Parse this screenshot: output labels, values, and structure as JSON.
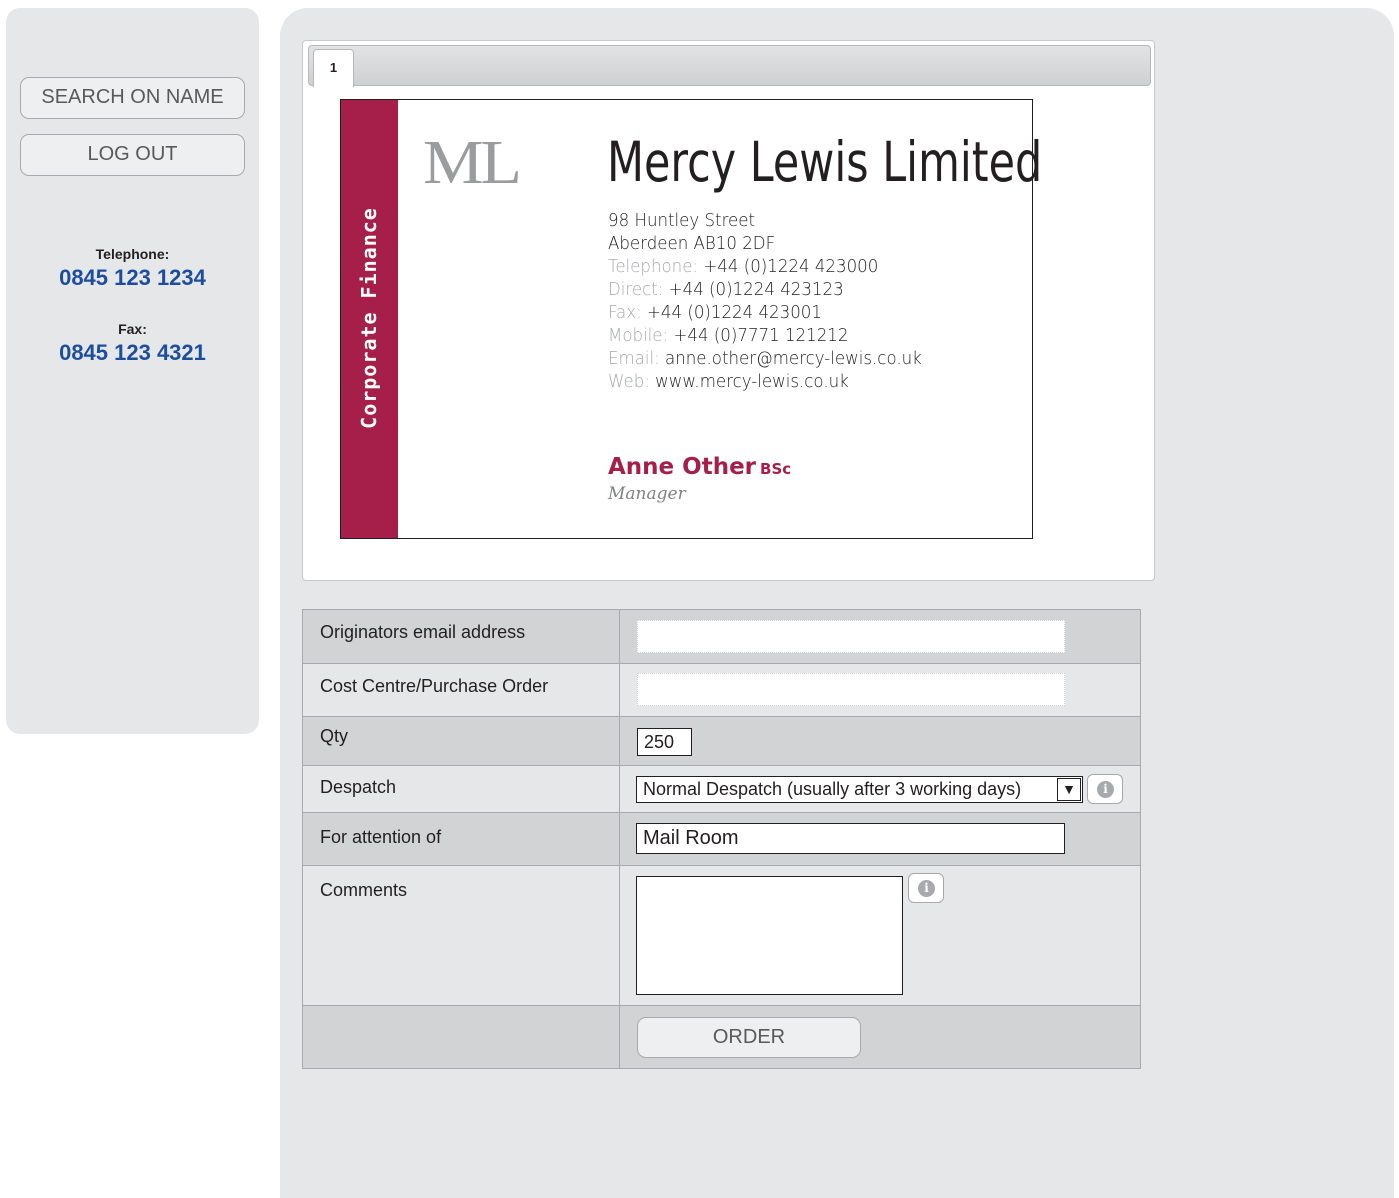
{
  "sidebar": {
    "search_label": "SEARCH ON NAME",
    "logout_label": "LOG OUT",
    "telephone_label": "Telephone:",
    "telephone_value": "0845 123 1234",
    "fax_label": "Fax:",
    "fax_value": "0845 123 4321"
  },
  "proof": {
    "tabs": [
      {
        "label": "1"
      }
    ],
    "card": {
      "strip_text": "Corporate Finance",
      "logo": "ML",
      "company": "Mercy Lewis Limited",
      "address_line1": "98 Huntley Street",
      "address_line2": "Aberdeen AB10 2DF",
      "telephone_label": "Telephone:",
      "telephone_value": "+44 (0)1224 423000",
      "direct_label": "Direct:",
      "direct_value": "+44 (0)1224 423123",
      "fax_label": "Fax:",
      "fax_value": "+44 (0)1224 423001",
      "mobile_label": "Mobile:",
      "mobile_value": "+44 (0)7771 121212",
      "email_label": "Email:",
      "email_value": "anne.other@mercy-lewis.co.uk",
      "web_label": "Web:",
      "web_value": "www.mercy-lewis.co.uk",
      "name": "Anne Other",
      "name_suffix": "BSc",
      "role": "Manager"
    }
  },
  "form": {
    "email_label": "Originators email address",
    "email_value": "",
    "cost_label": "Cost Centre/Purchase Order",
    "cost_value": "",
    "qty_label": "Qty",
    "qty_value": "250",
    "despatch_label": "Despatch",
    "despatch_value": "Normal Despatch (usually after 3 working days)",
    "attention_label": "For attention of",
    "attention_value": "Mail Room",
    "comments_label": "Comments",
    "comments_value": "",
    "order_label": "ORDER"
  },
  "colors": {
    "brand": "#a51f4a",
    "contact_blue": "#1d4e9e",
    "panel_gray": "#e6e7e8",
    "row_gray": "#d1d3d4"
  },
  "icons": [
    "info-icon",
    "dropdown-arrow-icon"
  ]
}
